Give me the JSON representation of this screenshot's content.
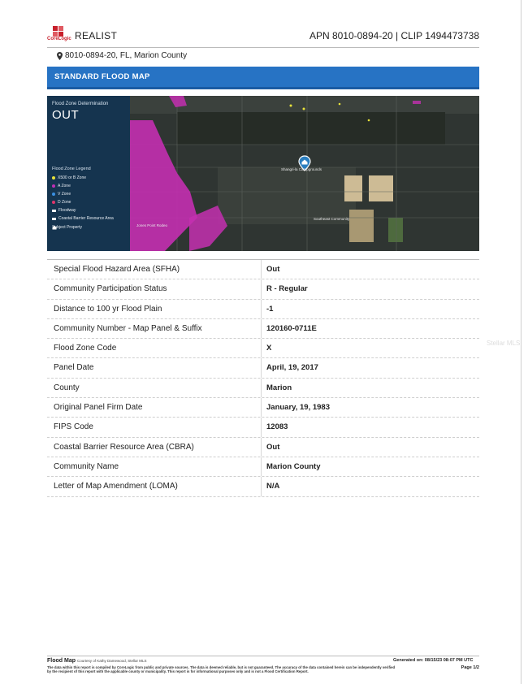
{
  "header": {
    "logo_text": "CoreLogic",
    "product": "REALIST",
    "apn_clip": "APN 8010-0894-20 | CLIP 1494473738"
  },
  "address": "8010-0894-20, FL, Marion County",
  "section_title": "STANDARD FLOOD MAP",
  "map": {
    "determination_caption": "Flood Zone Determination",
    "determination_value": "OUT",
    "legend_title": "Flood Zone Legend",
    "legend": [
      {
        "label": "X500 or B Zone",
        "color": "#e8e23a",
        "shape": "dot"
      },
      {
        "label": "A Zone",
        "color": "#c02fb5",
        "shape": "dot"
      },
      {
        "label": "V Zone",
        "color": "#3a8fe0",
        "shape": "dot"
      },
      {
        "label": "D Zone",
        "color": "#e0356a",
        "shape": "dot"
      },
      {
        "label": "Floodway",
        "color": "#ffffff",
        "shape": "square"
      },
      {
        "label": "Coastal Barrier Resource Area",
        "color": "#ffffff",
        "shape": "square"
      },
      {
        "label": "Subject Property",
        "color": "#ffffff",
        "shape": "home-icon"
      }
    ],
    "place_labels": [
      "Shangri-la Campgrounds",
      "Southeast Community",
      "Jones Point Rodeo"
    ]
  },
  "flood_table": [
    {
      "label": "Special Flood Hazard Area (SFHA)",
      "value": "Out"
    },
    {
      "label": "Community Participation Status",
      "value": "R - Regular"
    },
    {
      "label": "Distance to 100 yr Flood Plain",
      "value": "-1"
    },
    {
      "label": "Community Number - Map Panel & Suffix",
      "value": "120160-0711E"
    },
    {
      "label": "Flood Zone Code",
      "value": "X"
    },
    {
      "label": "Panel Date",
      "value": "April, 19, 2017"
    },
    {
      "label": "County",
      "value": "Marion"
    },
    {
      "label": "Original Panel Firm Date",
      "value": "January, 19, 1983"
    },
    {
      "label": "FIPS Code",
      "value": "12083"
    },
    {
      "label": "Coastal Barrier Resource Area (CBRA)",
      "value": "Out"
    },
    {
      "label": "Community Name",
      "value": "Marion County"
    },
    {
      "label": "Letter of Map Amendment (LOMA)",
      "value": "N/A"
    }
  ],
  "watermark": "Stellar MLS",
  "footer": {
    "title": "Flood Map",
    "courtesy": "Courtesy of Kathy Damewood, Stellar MLS",
    "generated": "Generated on: 08/15/23 08:07 PM UTC",
    "page": "Page 1/2",
    "disclaimer": "The data within this report is compiled by CoreLogic from public and private sources. The data is deemed reliable, but is not guaranteed. The accuracy of the data contained herein can be independently verified by the recipient of this report with the applicable county or municipality. This report is for informational purposes only and is not a Flood Certification Report."
  }
}
